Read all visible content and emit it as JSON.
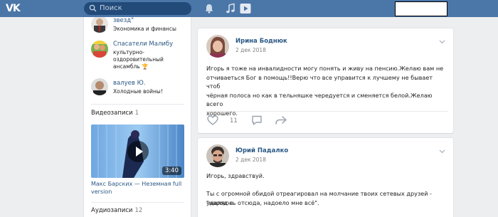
{
  "header": {
    "logo": "VK",
    "search_placeholder": "Поиск",
    "user_box": ""
  },
  "sidebar": {
    "groups": [
      {
        "name": "звезд\"",
        "desc": "Экономика и финансы"
      },
      {
        "name": "Спасатели Малибу",
        "desc_lines": [
          "культурно-",
          "оздоровительный",
          "ансамбль 🏆"
        ]
      },
      {
        "name": "валуев Ю.",
        "desc": "Холодные войны!"
      }
    ],
    "videos": {
      "title": "Видеозаписи",
      "count": "1",
      "item_title": "Макс Барских — Неземная full version",
      "duration": "3:40"
    },
    "audio": {
      "title": "Аудиозаписи",
      "count": "12"
    }
  },
  "posts": [
    {
      "author": "Ирина Боднюк",
      "date": "2 дек 2018",
      "text_lines": [
        "Игорь я тоже на инвалидности могу понять и живу на пенсию.Желаю вам не",
        "отчиваеться Бог в помощь!!Верю что все управится к лучшему не бывает чтоб",
        "чёрная полоса но как в тельняшке чередуется и сменяется белой.Желаю всего",
        "хорошего."
      ],
      "likes": "11"
    },
    {
      "author": "Юрий Падалко",
      "date": "2 дек 2018",
      "text_lines": [
        "Игорь, здравствуй.",
        "Ты с огромной обидой отреагировал на молчание твоих сетевых друзей - \"народ я",
        "удаляюсь отсюда, надоело мне всё\"."
      ]
    }
  ],
  "colors": {
    "header": "#4a76a8",
    "link": "#2a5885",
    "bg": "#edeef0"
  }
}
